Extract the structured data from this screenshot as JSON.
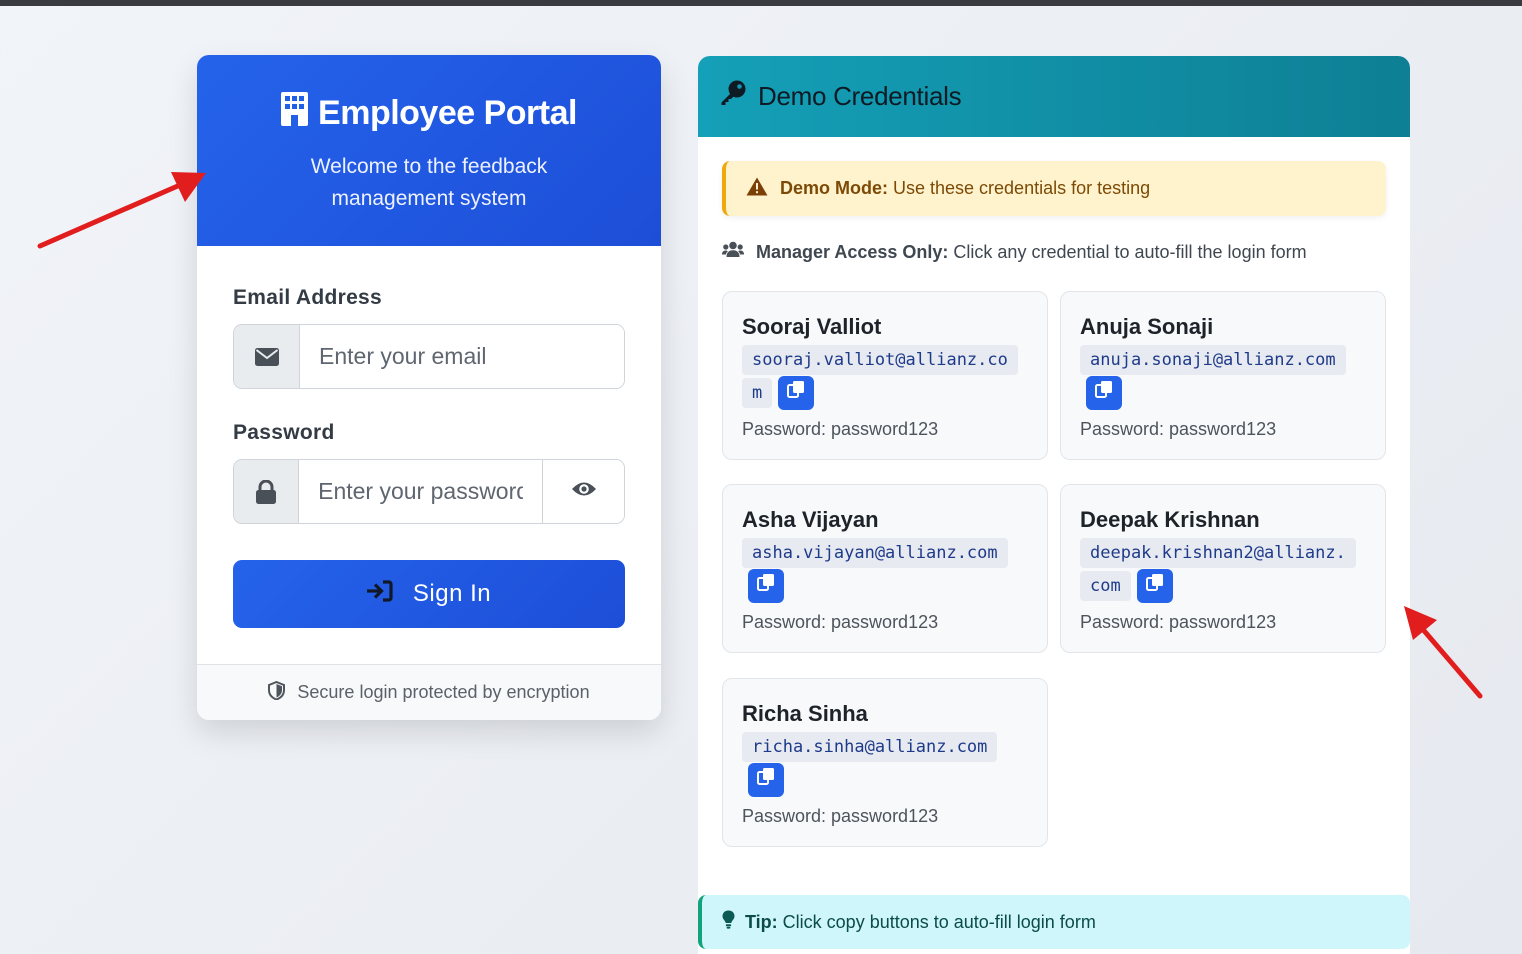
{
  "login": {
    "title": "Employee Portal",
    "subtitle": "Welcome to the feedback management system",
    "email_label": "Email Address",
    "email_placeholder": "Enter your email",
    "email_value": "",
    "password_label": "Password",
    "password_placeholder": "Enter your password",
    "password_value": "",
    "signin_label": "Sign In",
    "footer": "Secure login protected by encryption"
  },
  "credentials": {
    "title": "Demo Credentials",
    "alert_bold": "Demo Mode:",
    "alert_text": " Use these credentials for testing",
    "manager_bold": "Manager Access Only:",
    "manager_text": " Click any credential to auto-fill the login form",
    "items": [
      {
        "name": "Sooraj Valliot",
        "email": "sooraj.valliot@allianz.com",
        "password": "Password: password123"
      },
      {
        "name": "Anuja Sonaji",
        "email": "anuja.sonaji@allianz.com",
        "password": "Password: password123"
      },
      {
        "name": "Asha Vijayan",
        "email": "asha.vijayan@allianz.com",
        "password": "Password: password123"
      },
      {
        "name": "Deepak Krishnan",
        "email": "deepak.krishnan2@allianz.com",
        "password": "Password: password123"
      },
      {
        "name": "Richa Sinha",
        "email": "richa.sinha@allianz.com",
        "password": "Password: password123"
      }
    ],
    "tip_bold": "Tip:",
    "tip_text": " Click copy buttons to auto-fill login form"
  },
  "icons": {
    "title": "building-icon",
    "email": "envelope-icon",
    "password": "lock-icon",
    "toggle": "eye-icon",
    "signin": "sign-in-icon",
    "footer": "shield-icon",
    "credentials": "key-icon",
    "alert": "warning-icon",
    "manager": "users-icon",
    "copy": "copy-icon",
    "tip": "lightbulb-icon"
  },
  "colors": {
    "primary": "#2563eb",
    "teal_header": "#0e7f94",
    "alert_bg": "#fff3cd",
    "tip_bg": "#cff6fb",
    "annotation_arrow": "#e11d1d"
  }
}
